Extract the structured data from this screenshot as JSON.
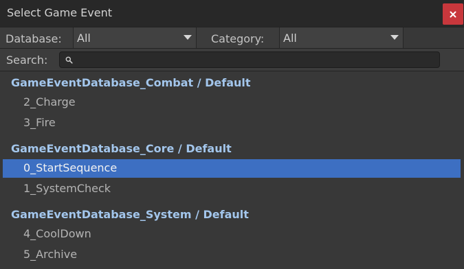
{
  "window": {
    "title": "Select Game Event"
  },
  "filters": {
    "database_label": "Database:",
    "database_value": "All",
    "category_label": "Category:",
    "category_value": "All"
  },
  "search": {
    "label": "Search:",
    "value": "",
    "placeholder": ""
  },
  "groups": [
    {
      "title": "GameEventDatabase_Combat / Default",
      "items": [
        {
          "label": "2_Charge"
        },
        {
          "label": "3_Fire"
        }
      ]
    },
    {
      "title": "GameEventDatabase_Core / Default",
      "items": [
        {
          "label": "0_StartSequence",
          "selected": true
        },
        {
          "label": "1_SystemCheck"
        }
      ]
    },
    {
      "title": "GameEventDatabase_System / Default",
      "items": [
        {
          "label": "4_CoolDown"
        },
        {
          "label": "5_Archive"
        }
      ]
    }
  ],
  "colors": {
    "selection": "#3d6fc2",
    "group_header": "#a3c6ec",
    "close_button": "#c8373c"
  }
}
